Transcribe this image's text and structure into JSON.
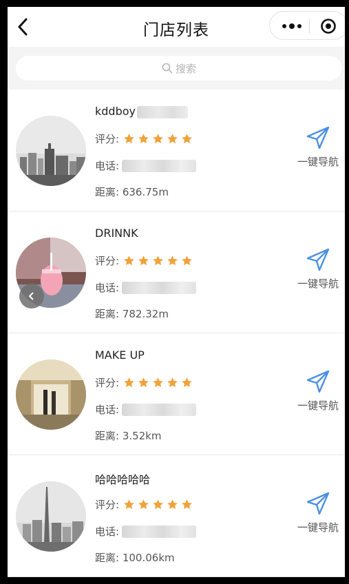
{
  "header": {
    "title": "门店列表"
  },
  "search": {
    "placeholder": "搜索"
  },
  "labels": {
    "rating": "评分:",
    "phone": "电话:",
    "distance_prefix": "距离:",
    "navigate": "一键导航"
  },
  "stores": [
    {
      "name": "kddboy",
      "rating": 5,
      "phone_prefix": "",
      "distance": "636.75m"
    },
    {
      "name": "DRINNK",
      "rating": 5,
      "phone_prefix": "",
      "distance": "782.32m"
    },
    {
      "name": "MAKE UP",
      "rating": 5,
      "phone_prefix": "",
      "distance": "3.52km"
    },
    {
      "name": "哈哈哈哈哈",
      "rating": 5,
      "phone_prefix": "",
      "distance": "100.06km"
    }
  ],
  "colors": {
    "star": "#f0a23b",
    "nav_icon": "#4a90e2"
  },
  "icons": {
    "back": "chevron-left-icon",
    "more": "more-dots-icon",
    "target": "target-icon",
    "search": "search-icon",
    "star": "star-icon",
    "navigate": "navigation-arrow-icon"
  }
}
